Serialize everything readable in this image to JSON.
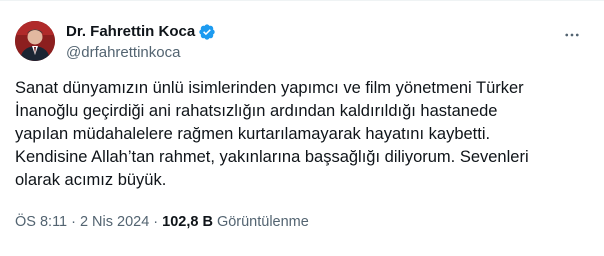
{
  "author": {
    "display_name": "Dr. Fahrettin Koca",
    "handle": "@drfahrettinkoca",
    "verified": true,
    "verified_color": "#1d9bf0"
  },
  "tweet": {
    "lines": [
      "Sanat dünyamızın ünlü isimlerinden yapımcı ve film yönetmeni Türker",
      "İnanoğlu geçirdiği ani rahatsızlığın ardından kaldırıldığı hastanede",
      "yapılan müdahalelere rağmen kurtarılamayarak hayatını kaybetti.",
      "Kendisine Allah’tan rahmet, yakınlarına başsağlığı diliyorum. Sevenleri",
      "olarak acımız büyük."
    ]
  },
  "meta": {
    "time": "ÖS 8:11",
    "separator": "·",
    "date": "2 Nis 2024",
    "views_count": "102,8 B",
    "views_label": "Görüntülenme"
  },
  "icons": {
    "avatar": "profile-photo",
    "verified": "verified-badge-icon",
    "more": "more-options-icon"
  }
}
